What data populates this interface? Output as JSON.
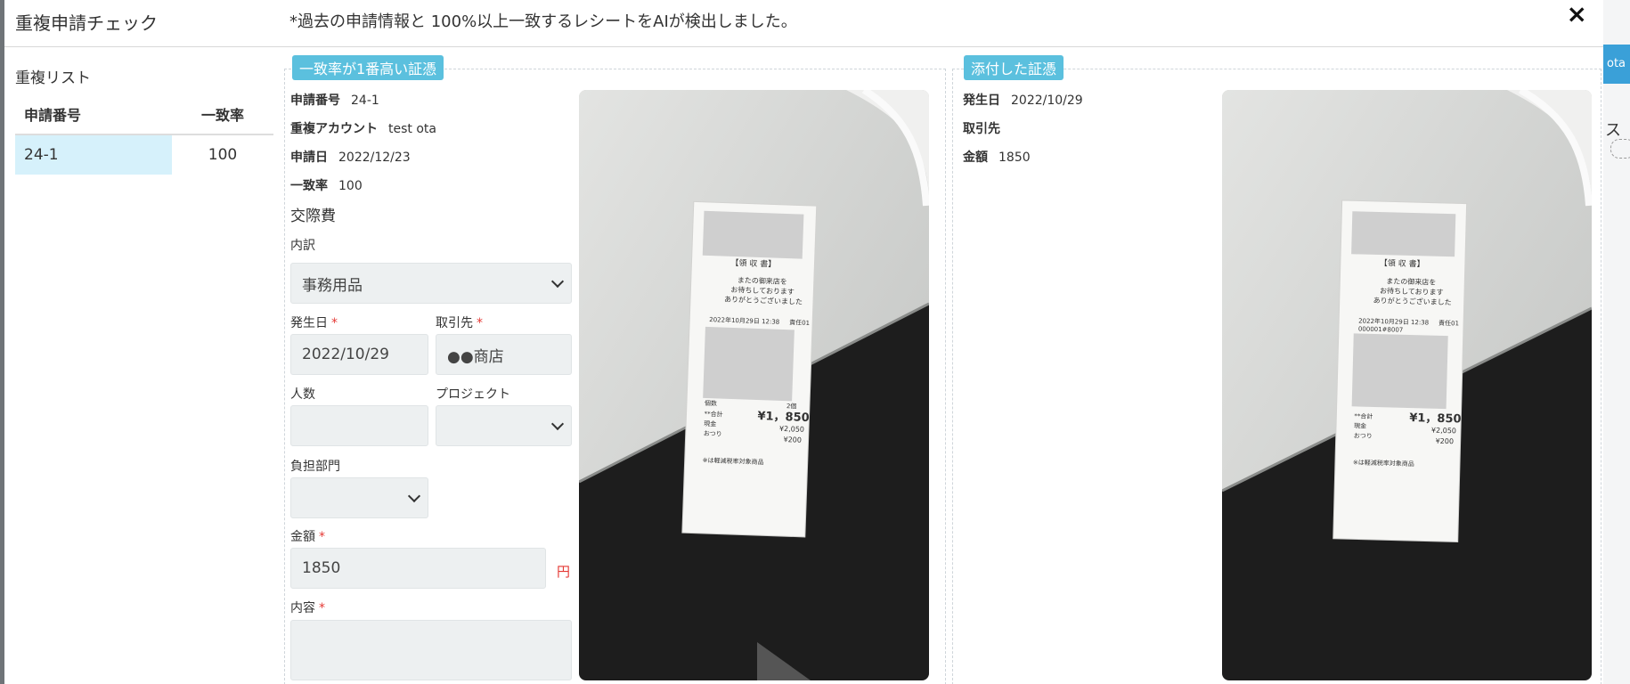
{
  "header": {
    "title": "重複申請チェック",
    "notice": "*過去の申請情報と 100%以上一致するレシートをAIが検出しました。",
    "close": "×"
  },
  "duplicate_list": {
    "label": "重複リスト",
    "headers": {
      "number": "申請番号",
      "rate": "一致率"
    },
    "rows": [
      {
        "number": "24-1",
        "rate": "100"
      }
    ]
  },
  "left_panel": {
    "badge": "一致率が1番高い証憑",
    "meta": [
      {
        "label": "申請番号",
        "value": "24-1"
      },
      {
        "label": "重複アカウント",
        "value": "test ota"
      },
      {
        "label": "申請日",
        "value": "2022/12/23"
      },
      {
        "label": "一致率",
        "value": "100"
      }
    ],
    "category": "交際費",
    "breakdown": {
      "label": "内訳",
      "value": "事務用品"
    },
    "date": {
      "label": "発生日",
      "value": "2022/10/29"
    },
    "vendor": {
      "label": "取引先",
      "value": "●●商店"
    },
    "people": {
      "label": "人数",
      "value": ""
    },
    "project": {
      "label": "プロジェクト",
      "value": ""
    },
    "dept": {
      "label": "負担部門",
      "value": ""
    },
    "amount": {
      "label": "金額",
      "value": "1850",
      "unit": "円"
    },
    "content": {
      "label": "内容",
      "value": ""
    }
  },
  "right_panel": {
    "badge": "添付した証憑",
    "meta": [
      {
        "label": "発生日",
        "value": "2022/10/29"
      },
      {
        "label": "取引先",
        "value": ""
      },
      {
        "label": "金額",
        "value": "1850"
      }
    ]
  },
  "receipt": {
    "title": "【領 収 書】",
    "greeting1": "またの御来店を",
    "greeting2": "お待ちしております",
    "greeting3": "ありがとうございました",
    "datetime": "2022年10月29日 12:38",
    "staff": "責任01",
    "count_label": "個数",
    "count_value": "2個",
    "total_label": "**合計",
    "total_value": "¥1，850",
    "cash_label": "現金",
    "cash_value": "¥2,050",
    "change_label": "おつり",
    "change_value": "¥200",
    "note": "※は軽減税率対象商品",
    "receipt_no": "000001#8007"
  },
  "side_peek": {
    "button": "ota",
    "text": "ス"
  },
  "colors": {
    "accent": "#5bc0de",
    "required": "#e53935",
    "selected_row": "#d6f1fb"
  }
}
